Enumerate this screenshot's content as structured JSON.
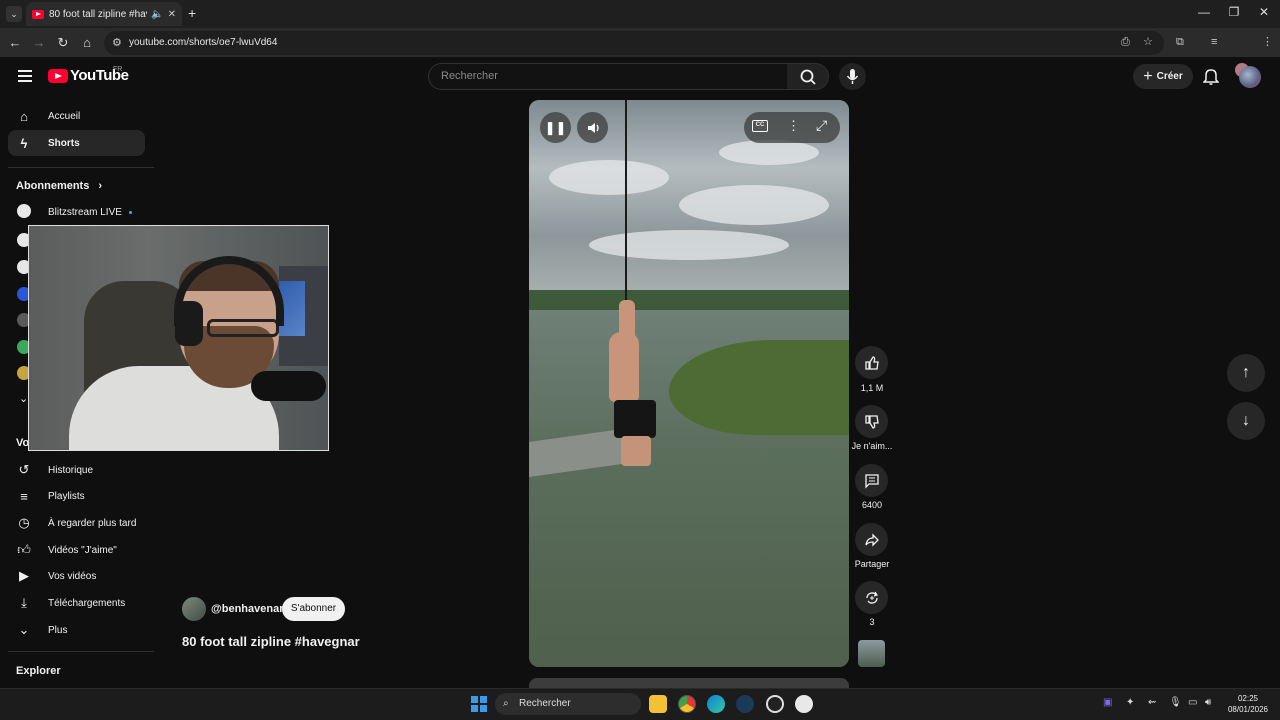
{
  "browser": {
    "tab_title": "80 foot tall zipline #havegnar",
    "url": "youtube.com/shorts/oe7-lwuVd64",
    "new_tab_symbol": "+",
    "window_controls": [
      "—",
      "❐",
      "✕"
    ]
  },
  "header": {
    "logo_text": "YouTube",
    "logo_country": "FR",
    "search_placeholder": "Rechercher",
    "create_label": "Créer"
  },
  "sidebar": {
    "main_items": [
      {
        "label": "Accueil",
        "icon": "home-icon"
      },
      {
        "label": "Shorts",
        "icon": "shorts-icon"
      }
    ],
    "subscriptions_heading": "Abonnements",
    "subscriptions": [
      {
        "label": "Blitzstream LIVE",
        "live": true
      }
    ],
    "you_heading_partial": "Vo",
    "you_items": [
      {
        "label": "Historique",
        "icon": "history-icon"
      },
      {
        "label": "Playlists",
        "icon": "playlist-icon"
      },
      {
        "label": "À regarder plus tard",
        "icon": "clock-icon"
      },
      {
        "label": "Vidéos \"J'aime\"",
        "icon": "thumb-up-icon"
      },
      {
        "label": "Vos vidéos",
        "icon": "video-icon"
      },
      {
        "label": "Téléchargements",
        "icon": "download-icon"
      },
      {
        "label": "Plus",
        "icon": "chevron-down-icon"
      }
    ],
    "explore_heading": "Explorer"
  },
  "short": {
    "channel": "@benhavenar",
    "subscribe_label": "S'abonner",
    "title": "80 foot tall zipline #havegnar",
    "actions": [
      {
        "icon": "thumb-up-icon",
        "label": "1,1 M"
      },
      {
        "icon": "thumb-down-icon",
        "label": "Je n'aim..."
      },
      {
        "icon": "comment-icon",
        "label": "6400"
      },
      {
        "icon": "share-icon",
        "label": "Partager"
      },
      {
        "icon": "remix-icon",
        "label": "3"
      }
    ]
  },
  "taskbar": {
    "search_label": "Rechercher",
    "time": "02:25",
    "date": "08/01/2026"
  },
  "colors": {
    "youtube_red": "#ff0033",
    "background": "#0f0f0f",
    "live_dot": "#3ea6ff"
  }
}
